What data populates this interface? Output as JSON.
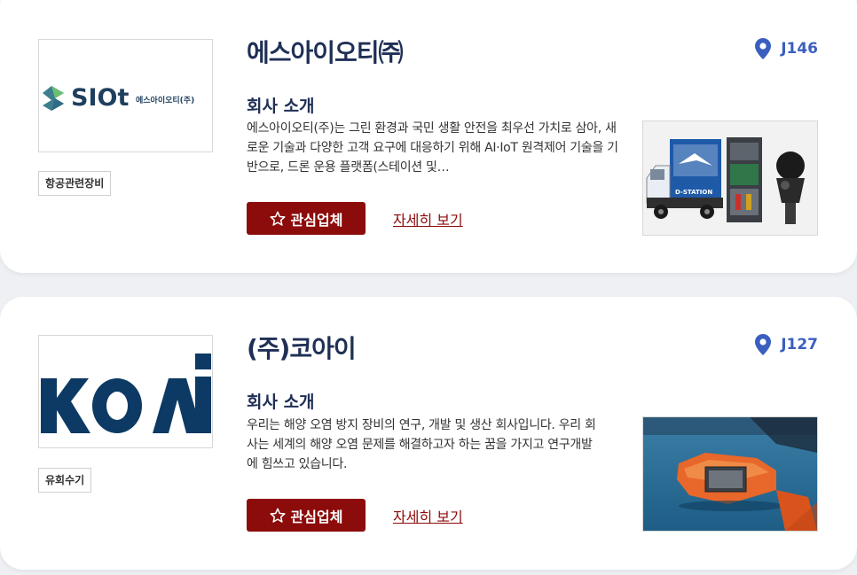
{
  "companies": [
    {
      "name": "에스아이오티㈜",
      "booth": "J146",
      "category": "항공관련장비",
      "intro_title": "회사 소개",
      "description": "에스아이오티(주)는 그린 환경과 국민 생활 안전을 최우선 가치로 삼아, 새로운 기술과 다양한 고객 요구에 대응하기 위해 AI·IoT 원격제어 기술을 기반으로, 드론 운용 플랫폼(스테이션 및…",
      "fav_label": "관심업체",
      "detail_label": "자세히 보기",
      "logo_text": "SIOt",
      "logo_sub": "에스아이오티(주)",
      "product_label": "D-STATION"
    },
    {
      "name": "(주)코아이",
      "booth": "J127",
      "category": "유회수기",
      "intro_title": "회사 소개",
      "description": "우리는 해양 오염 방지 장비의 연구, 개발 및 생산 회사입니다. 우리 회사는 세계의 해양 오염 문제를 해결하고자 하는 꿈을 가지고 연구개발에 힘쓰고 있습니다.",
      "fav_label": "관심업체",
      "detail_label": "자세히 보기",
      "logo_text": "KOAi"
    }
  ],
  "colors": {
    "accent_red": "#8c0b0b",
    "title_navy": "#1f2f55",
    "booth_blue": "#3b5fbf",
    "koai_navy": "#0d3a64",
    "siot_teal": "#2e9a8a"
  },
  "icons": [
    "location-pin-icon",
    "star-outline-icon"
  ]
}
